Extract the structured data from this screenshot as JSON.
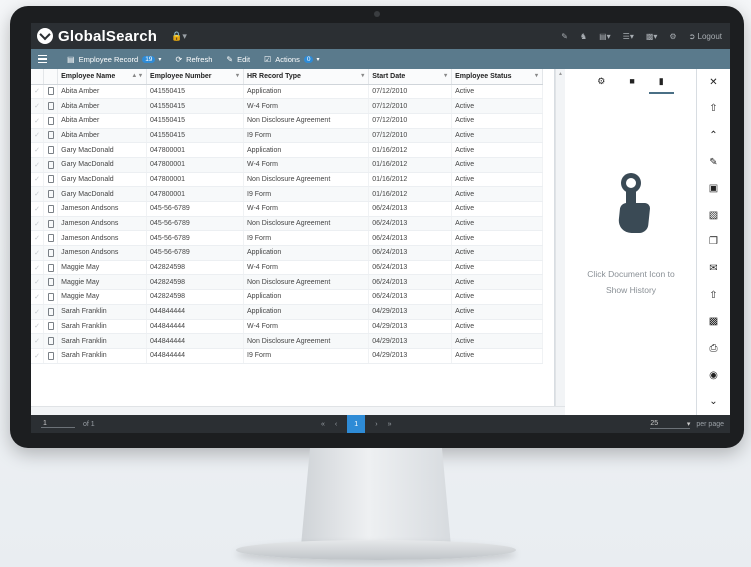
{
  "app": {
    "title": "GlobalSearch",
    "lock_icon": "lock-icon",
    "logout_label": "Logout"
  },
  "toolbar": {
    "record_label": "Employee Record",
    "record_count": "19",
    "refresh_label": "Refresh",
    "edit_label": "Edit",
    "actions_label": "Actions",
    "actions_count": "0"
  },
  "table": {
    "columns": [
      "Employee Name",
      "Employee Number",
      "HR Record Type",
      "Start Date",
      "Employee Status"
    ],
    "rows": [
      [
        "Abita Amber",
        "041550415",
        "Application",
        "07/12/2010",
        "Active"
      ],
      [
        "Abita Amber",
        "041550415",
        "W-4 Form",
        "07/12/2010",
        "Active"
      ],
      [
        "Abita Amber",
        "041550415",
        "Non Disclosure Agreement",
        "07/12/2010",
        "Active"
      ],
      [
        "Abita Amber",
        "041550415",
        "I9 Form",
        "07/12/2010",
        "Active"
      ],
      [
        "Gary MacDonald",
        "047800001",
        "Application",
        "01/16/2012",
        "Active"
      ],
      [
        "Gary MacDonald",
        "047800001",
        "W-4 Form",
        "01/16/2012",
        "Active"
      ],
      [
        "Gary MacDonald",
        "047800001",
        "Non Disclosure Agreement",
        "01/16/2012",
        "Active"
      ],
      [
        "Gary MacDonald",
        "047800001",
        "I9 Form",
        "01/16/2012",
        "Active"
      ],
      [
        "Jameson Andsons",
        "045-56-6789",
        "W-4 Form",
        "06/24/2013",
        "Active"
      ],
      [
        "Jameson Andsons",
        "045-56-6789",
        "Non Disclosure Agreement",
        "06/24/2013",
        "Active"
      ],
      [
        "Jameson Andsons",
        "045-56-6789",
        "I9 Form",
        "06/24/2013",
        "Active"
      ],
      [
        "Jameson Andsons",
        "045-56-6789",
        "Application",
        "06/24/2013",
        "Active"
      ],
      [
        "Maggie May",
        "042824598",
        "W-4 Form",
        "06/24/2013",
        "Active"
      ],
      [
        "Maggie May",
        "042824598",
        "Non Disclosure Agreement",
        "06/24/2013",
        "Active"
      ],
      [
        "Maggie May",
        "042824598",
        "Application",
        "06/24/2013",
        "Active"
      ],
      [
        "Sarah Franklin",
        "044844444",
        "Application",
        "04/29/2013",
        "Active"
      ],
      [
        "Sarah Franklin",
        "044844444",
        "W-4 Form",
        "04/29/2013",
        "Active"
      ],
      [
        "Sarah Franklin",
        "044844444",
        "Non Disclosure Agreement",
        "04/29/2013",
        "Active"
      ],
      [
        "Sarah Franklin",
        "044844444",
        "I9 Form",
        "04/29/2013",
        "Active"
      ]
    ]
  },
  "panel": {
    "hint_line1": "Click Document Icon to",
    "hint_line2": "Show History"
  },
  "footer": {
    "page_value": "1",
    "of_label": "of 1",
    "current_page": "1",
    "per_page_value": "25",
    "per_page_label": "per page",
    "first": "«",
    "prev": "‹",
    "next": "›",
    "last": "»"
  },
  "colors": {
    "header_bg": "#2b2f33",
    "toolbar_bg": "#5a7a8c",
    "accent": "#2e8bd6"
  }
}
